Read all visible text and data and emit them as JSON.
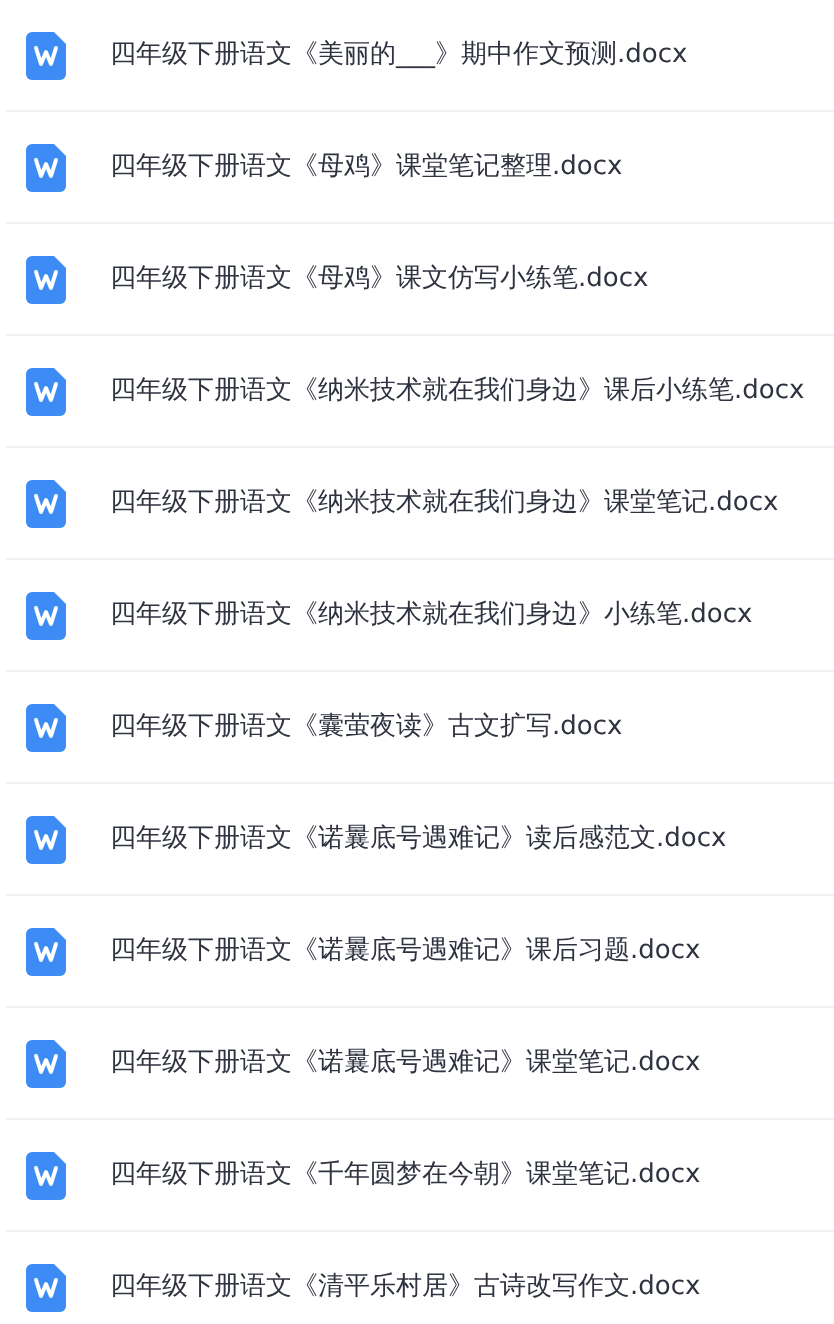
{
  "files": [
    {
      "name": "四年级下册语文《美丽的___》期中作文预测.docx"
    },
    {
      "name": "四年级下册语文《母鸡》课堂笔记整理.docx"
    },
    {
      "name": "四年级下册语文《母鸡》课文仿写小练笔.docx"
    },
    {
      "name": "四年级下册语文《纳米技术就在我们身边》课后小练笔.docx"
    },
    {
      "name": "四年级下册语文《纳米技术就在我们身边》课堂笔记.docx"
    },
    {
      "name": "四年级下册语文《纳米技术就在我们身边》小练笔.docx"
    },
    {
      "name": "四年级下册语文《囊萤夜读》古文扩写.docx"
    },
    {
      "name": "四年级下册语文《诺曩底号遇难记》读后感范文.docx"
    },
    {
      "name": "四年级下册语文《诺曩底号遇难记》课后习题.docx"
    },
    {
      "name": "四年级下册语文《诺曩底号遇难记》课堂笔记.docx"
    },
    {
      "name": "四年级下册语文《千年圆梦在今朝》课堂笔记.docx"
    },
    {
      "name": "四年级下册语文《清平乐村居》古诗改写作文.docx"
    }
  ]
}
